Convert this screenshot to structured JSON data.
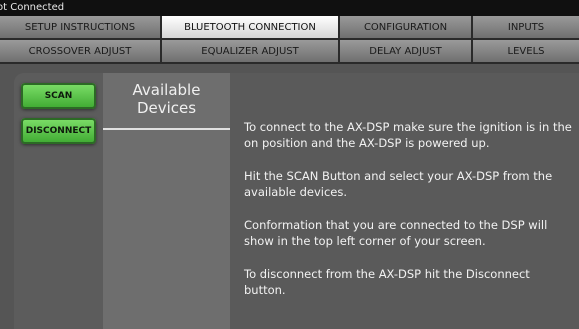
{
  "status": {
    "text": "ot Connected"
  },
  "tabs_row1": [
    {
      "label": "SETUP INSTRUCTIONS",
      "active": false
    },
    {
      "label": "BLUETOOTH CONNECTION",
      "active": true
    },
    {
      "label": "CONFIGURATION",
      "active": false
    },
    {
      "label": "INPUTS",
      "active": false
    }
  ],
  "tabs_row2": [
    {
      "label": "CROSSOVER ADJUST",
      "active": false
    },
    {
      "label": "EQUALIZER ADJUST",
      "active": false
    },
    {
      "label": "DELAY ADJUST",
      "active": false
    },
    {
      "label": "LEVELS",
      "active": false
    }
  ],
  "buttons": {
    "scan": "SCAN",
    "disconnect": "DISCONNECT"
  },
  "devices": {
    "title_line1": "Available",
    "title_line2": "Devices"
  },
  "instructions": [
    "To connect to the AX-DSP make sure the ignition is in the on position and the AX-DSP is powered up.",
    "Hit the SCAN Button and select your AX-DSP from the available devices.",
    "Conformation that you are connected to the DSP will show in the top left corner of your screen.",
    "To disconnect from the AX-DSP hit the Disconnect button."
  ],
  "colors": {
    "active_tab": "#ffffff",
    "inactive_tab": "#8a8a8a",
    "button_green": "#5cc84a",
    "background": "#5a5a5a"
  }
}
